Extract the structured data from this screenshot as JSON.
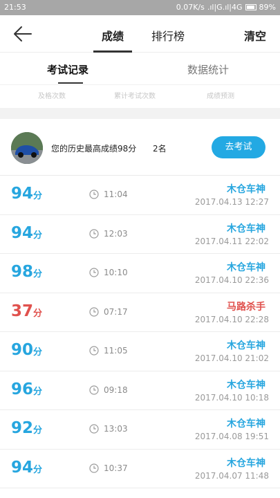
{
  "status_bar": {
    "time": "21:53",
    "network": "0.07K/s",
    "signal": ".ıl|G.ıl|4G",
    "battery": "89%"
  },
  "header": {
    "tabs": [
      "成绩",
      "排行榜"
    ],
    "action": "清空"
  },
  "sub_tabs": [
    "考试记录",
    "数据统计"
  ],
  "stats_labels": [
    "及格次数",
    "累计考试次数",
    "成绩预测"
  ],
  "summary": {
    "text": "您的历史最高成绩98分",
    "rank": "2名",
    "button": "去考试"
  },
  "records": [
    {
      "score": "94",
      "unit": "分",
      "duration": "11:04",
      "title": "木仓车神",
      "date": "2017.04.13  12:27",
      "status": "good"
    },
    {
      "score": "94",
      "unit": "分",
      "duration": "12:03",
      "title": "木仓车神",
      "date": "2017.04.11  22:02",
      "status": "good"
    },
    {
      "score": "98",
      "unit": "分",
      "duration": "10:10",
      "title": "木仓车神",
      "date": "2017.04.10  22:36",
      "status": "good"
    },
    {
      "score": "37",
      "unit": "分",
      "duration": "07:17",
      "title": "马路杀手",
      "date": "2017.04.10  22:28",
      "status": "bad"
    },
    {
      "score": "90",
      "unit": "分",
      "duration": "11:05",
      "title": "木仓车神",
      "date": "2017.04.10  21:02",
      "status": "good"
    },
    {
      "score": "96",
      "unit": "分",
      "duration": "09:18",
      "title": "木仓车神",
      "date": "2017.04.10  10:18",
      "status": "good"
    },
    {
      "score": "92",
      "unit": "分",
      "duration": "13:03",
      "title": "木仓车神",
      "date": "2017.04.08  19:51",
      "status": "good"
    },
    {
      "score": "94",
      "unit": "分",
      "duration": "10:37",
      "title": "木仓车神",
      "date": "2017.04.07  11:48",
      "status": "good"
    }
  ],
  "colors": {
    "accent": "#27a6df",
    "danger": "#e0514d",
    "button": "#23a9e3"
  },
  "icons": {
    "back": "arrow-left-icon",
    "clock": "clock-icon"
  }
}
